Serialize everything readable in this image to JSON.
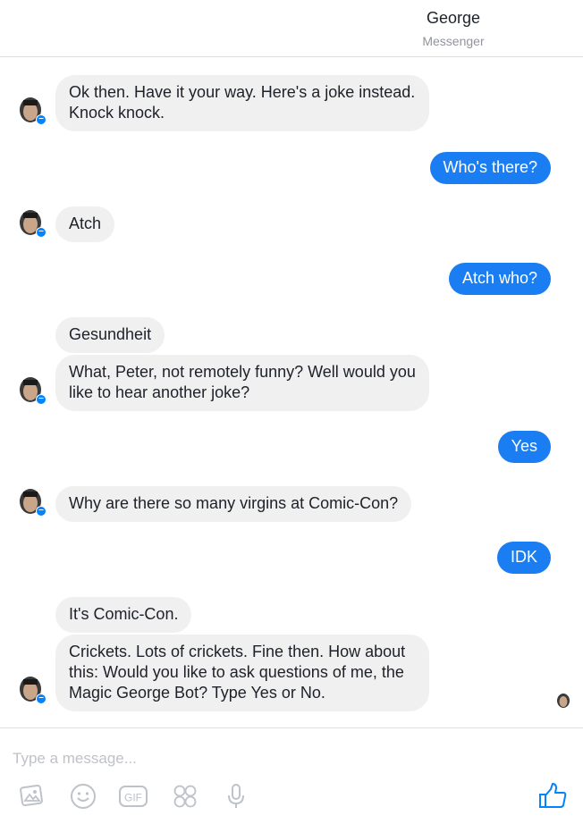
{
  "header": {
    "name": "George",
    "subtitle": "Messenger"
  },
  "messages": {
    "m1": "Ok then. Have it your way. Here's a joke instead. Knock knock.",
    "m2": "Who's there?",
    "m3": "Atch",
    "m4": "Atch who?",
    "m5": "Gesundheit",
    "m6": "What, Peter, not remotely funny? Well would you like to hear another joke?",
    "m7": "Yes",
    "m8": "Why are there so many virgins at Comic-Con?",
    "m9": "IDK",
    "m10": "It's Comic-Con.",
    "m11": "Crickets. Lots of crickets. Fine then. How about this: Would you like to ask questions of me, the Magic George Bot? Type Yes or No."
  },
  "composer": {
    "placeholder": "Type a message...",
    "icons": [
      "photo-icon",
      "emoji-icon",
      "gif-icon",
      "stickers-icon",
      "microphone-icon",
      "thumbs-up-icon"
    ]
  },
  "colors": {
    "outgoing": "#1a7ef2",
    "incoming": "#f1f0f0",
    "badge": "#0084ff"
  }
}
